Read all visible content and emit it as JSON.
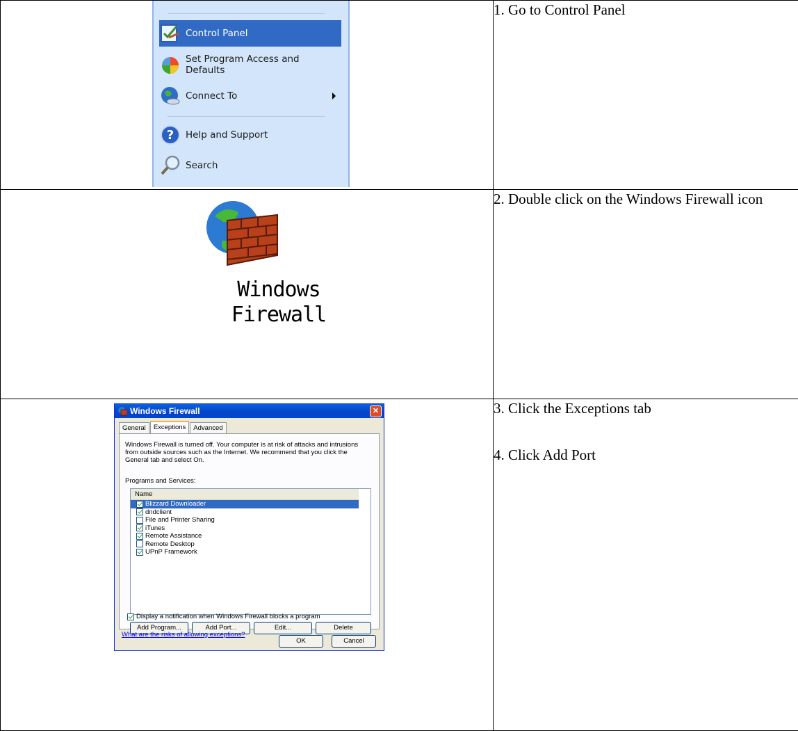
{
  "steps": {
    "step1": "1. Go to Control Panel",
    "step2": "2. Double click on the Windows Firewall icon",
    "step3": "3. Click the Exceptions tab",
    "step4": "4. Click Add Port"
  },
  "start_menu": {
    "control_panel": "Control Panel",
    "set_program_access_line1": "Set Program Access and",
    "set_program_access_line2": "Defaults",
    "connect_to": "Connect To",
    "help_and_support": "Help and Support",
    "search": "Search"
  },
  "firewall_icon": {
    "label_line1": "Windows",
    "label_line2": "Firewall"
  },
  "dialog": {
    "title": "Windows Firewall",
    "tabs": [
      "General",
      "Exceptions",
      "Advanced"
    ],
    "intro": "Windows Firewall is turned off. Your computer is at risk of attacks and intrusions from outside sources such as the Internet. We recommend that you click the General tab and select On.",
    "programs_label": "Programs and Services:",
    "list_header": "Name",
    "programs": [
      {
        "name": "Blizzard Downloader",
        "checked": true
      },
      {
        "name": "dndclient",
        "checked": true
      },
      {
        "name": "File and Printer Sharing",
        "checked": false
      },
      {
        "name": "iTunes",
        "checked": true
      },
      {
        "name": "Remote Assistance",
        "checked": true
      },
      {
        "name": "Remote Desktop",
        "checked": false
      },
      {
        "name": "UPnP Framework",
        "checked": true
      }
    ],
    "buttons": {
      "add_program": "Add Program...",
      "add_port": "Add Port...",
      "edit": "Edit...",
      "delete": "Delete",
      "ok": "OK",
      "cancel": "Cancel"
    },
    "notification": "Display a notification when Windows Firewall blocks a program",
    "risks_link": "What are the risks of allowing exceptions?"
  }
}
